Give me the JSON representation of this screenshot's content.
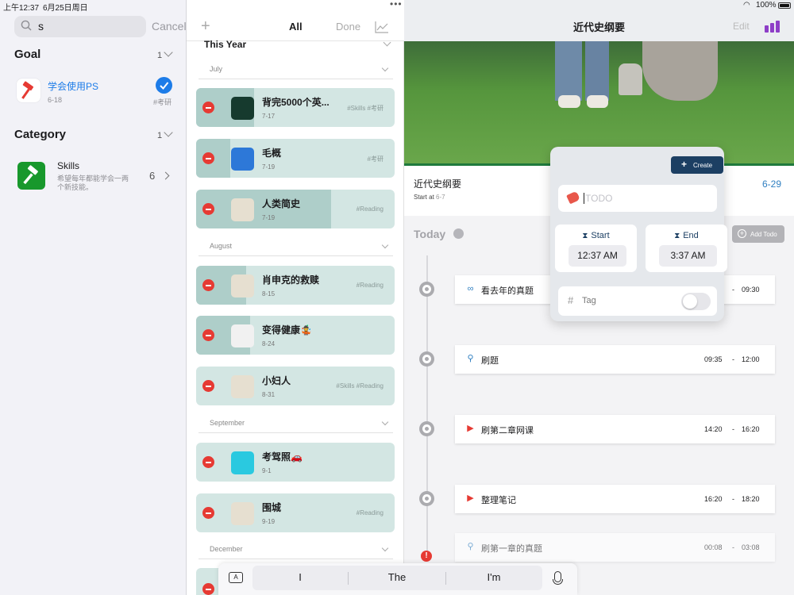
{
  "status": {
    "time": "上午12:37",
    "date": "6月25日周日",
    "battery": "100%"
  },
  "left": {
    "search": {
      "value": "s",
      "cancel": "Cancel"
    },
    "goal": {
      "heading": "Goal",
      "count": "1",
      "item": {
        "title": "学会使用PS",
        "date": "6-18",
        "tag": "#考研",
        "checked": true
      }
    },
    "category": {
      "heading": "Category",
      "count": "1",
      "item": {
        "title": "Skills",
        "desc": "希望每年都能学会一两个新技能。",
        "count": "6"
      }
    }
  },
  "middle": {
    "tabs": {
      "all": "All",
      "done": "Done"
    },
    "year": "This Year",
    "months": [
      "July",
      "August",
      "September",
      "December"
    ],
    "cards": [
      {
        "title": "背完5000个英...",
        "date": "7-17",
        "tag": "#Skills #考研",
        "progress": 0.29,
        "thumb": "map-icon"
      },
      {
        "title": "毛概",
        "date": "7-19",
        "tag": "#考研",
        "progress": 0.17,
        "thumb": "book-icon"
      },
      {
        "title": "人类简史",
        "date": "7-19",
        "tag": "#Reading",
        "progress": 0.68,
        "thumb": "book-cover"
      },
      {
        "title": "肖申克的救赎",
        "date": "8-15",
        "tag": "#Reading",
        "progress": 0.25,
        "thumb": "book-cover"
      },
      {
        "title": "变得健康🤹",
        "date": "8-24",
        "tag": "",
        "progress": 0.27,
        "thumb": "target-icon"
      },
      {
        "title": "小妇人",
        "date": "8-31",
        "tag": "#Skills #Reading",
        "progress": 0,
        "thumb": "book-cover"
      },
      {
        "title": "考驾照🚗",
        "date": "9-1",
        "tag": "",
        "progress": 0,
        "thumb": "car-icon"
      },
      {
        "title": "围城",
        "date": "9-19",
        "tag": "#Reading",
        "progress": 0,
        "thumb": "book-cover"
      }
    ]
  },
  "right": {
    "title": "近代史纲要",
    "edit": "Edit",
    "goal_name": "近代史纲要",
    "start_label": "Start at",
    "start_date": "6-7",
    "due": "6-29",
    "today": "Today",
    "add_todo": "Add Todo",
    "todos": [
      {
        "title": "看去年的真题",
        "start": "",
        "end": "09:30",
        "icon": "glasses-icon"
      },
      {
        "title": "刷题",
        "start": "09:35",
        "end": "12:00",
        "icon": "pin-icon"
      },
      {
        "title": "刷第二章网课",
        "start": "14:20",
        "end": "16:20",
        "icon": "tv-icon"
      },
      {
        "title": "整理笔记",
        "start": "16:20",
        "end": "18:20",
        "icon": "tv-icon"
      },
      {
        "title": "刷第一章的真题",
        "start": "00:08",
        "end": "03:08",
        "icon": "pin-icon"
      }
    ]
  },
  "popover": {
    "create": "Create",
    "placeholder": "TODO",
    "start_label": "Start",
    "start_time": "12:37 AM",
    "end_label": "End",
    "end_time": "3:37 AM",
    "tag_label": "Tag",
    "tag_enabled": false
  },
  "keyboard": {
    "suggestions": [
      "I",
      "The",
      "I'm"
    ]
  }
}
